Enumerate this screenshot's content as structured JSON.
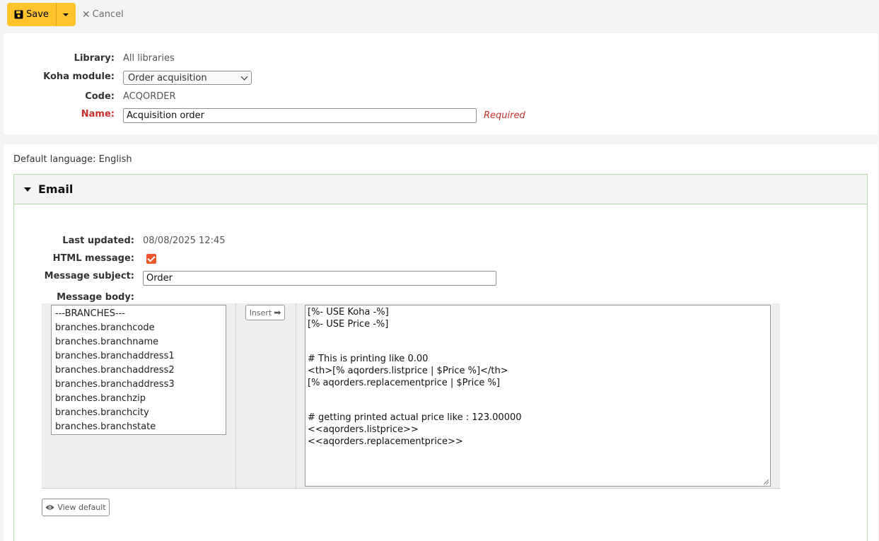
{
  "toolbar": {
    "save_label": "Save",
    "cancel_label": "Cancel"
  },
  "form": {
    "library_label": "Library:",
    "library_value": "All libraries",
    "module_label": "Koha module:",
    "module_value": "Order acquisition",
    "code_label": "Code:",
    "code_value": "ACQORDER",
    "name_label": "Name:",
    "name_value": "Acquisition order",
    "required_text": "Required"
  },
  "email": {
    "default_language": "Default language: English",
    "section_title": "Email",
    "last_updated_label": "Last updated:",
    "last_updated_value": "08/08/2025 12:45",
    "html_message_label": "HTML message:",
    "html_message_checked": true,
    "subject_label": "Message subject:",
    "subject_value": "Order",
    "body_label": "Message body:",
    "fields": [
      "---BRANCHES---",
      "branches.branchcode",
      "branches.branchname",
      "branches.branchaddress1",
      "branches.branchaddress2",
      "branches.branchaddress3",
      "branches.branchzip",
      "branches.branchcity",
      "branches.branchstate"
    ],
    "insert_label": "Insert",
    "body_lines": [
      "[%- USE Koha -%]",
      "[%- USE Price -%]",
      "",
      "",
      "# This is printing like 0.00",
      "<th>[% aqorders.listprice | $Price %]</th>",
      "[% aqorders.replacementprice | $Price %]",
      "",
      "",
      "# getting printed actual price like : 123.00000",
      "<<aqorders.listprice>>",
      "<<aqorders.replacementprice>>"
    ],
    "view_default_label": "View default"
  },
  "colors": {
    "accent": "#ffc32b",
    "required": "#c9302c",
    "checkbox": "#e8562a",
    "section_border": "#b9d8a8"
  }
}
